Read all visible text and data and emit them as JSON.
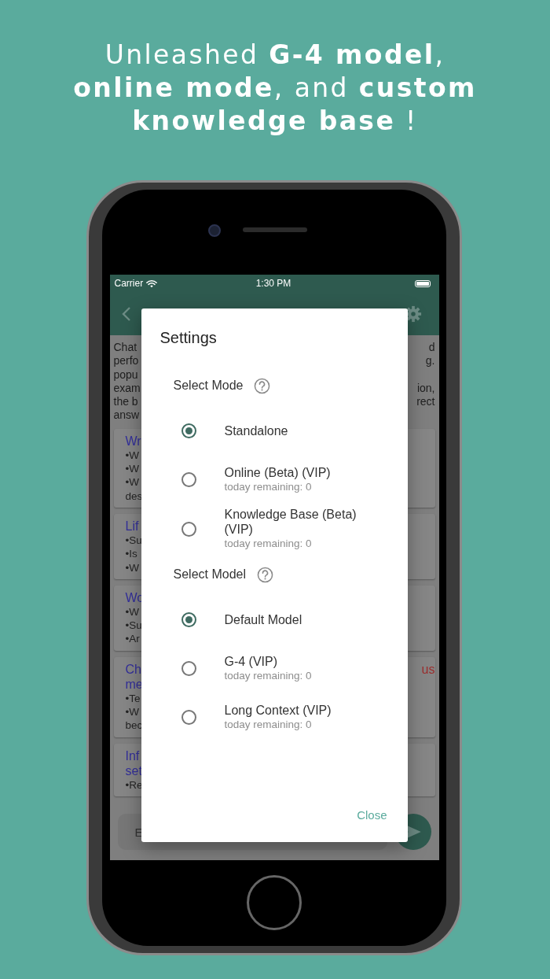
{
  "headline": [
    "Unleashed **G-4 model**,",
    "**online mode**, and **custom**",
    "**knowledge base** !"
  ],
  "status_bar": {
    "carrier": "Carrier",
    "time": "1:30 PM"
  },
  "intro": [
    {
      "left": "Chat",
      "right": "d"
    },
    {
      "left": "perfo",
      "right": "g."
    },
    {
      "left": "popu"
    },
    {
      "left": "exam",
      "right": "ion,"
    },
    {
      "left": "the b",
      "right": "rect"
    },
    {
      "left": "answ"
    }
  ],
  "cards": [
    {
      "title": [
        {
          "left": "Wr"
        }
      ],
      "lines": [
        "•W",
        "•W",
        "•W",
        "des"
      ]
    },
    {
      "title": [
        {
          "left": "Lif"
        }
      ],
      "lines": [
        "•Su",
        "•Is",
        "•W"
      ]
    },
    {
      "title": [
        {
          "left": "Wo"
        }
      ],
      "lines": [
        "•W",
        "•Su",
        "•Ar"
      ]
    },
    {
      "title": [
        {
          "left": "Ch",
          "right": "us"
        },
        {
          "left": "me"
        }
      ],
      "lines": [
        "•Te",
        "•W",
        "bec"
      ]
    },
    {
      "title": [
        {
          "left": "Inf"
        },
        {
          "left": "set"
        }
      ],
      "lines": [
        "•Re"
      ]
    }
  ],
  "input": {
    "placeholder": "E"
  },
  "dialog": {
    "title": "Settings",
    "sections": [
      {
        "label": "Select Mode",
        "options": [
          {
            "label": "Standalone",
            "selected": true
          },
          {
            "label": "Online (Beta) (VIP)",
            "note": "today remaining: 0",
            "selected": false
          },
          {
            "label": "Knowledge Base (Beta) (VIP)",
            "note": "today remaining: 0",
            "selected": false
          }
        ]
      },
      {
        "label": "Select Model",
        "options": [
          {
            "label": "Default Model",
            "selected": true
          },
          {
            "label": "G-4 (VIP)",
            "note": "today remaining: 0",
            "selected": false
          },
          {
            "label": "Long Context (VIP)",
            "note": "today remaining: 0",
            "selected": false
          }
        ]
      }
    ],
    "close": "Close"
  }
}
